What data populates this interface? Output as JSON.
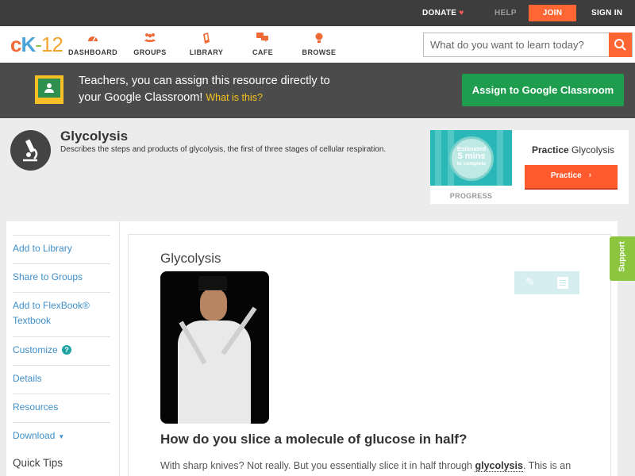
{
  "topbar": {
    "donate": "DONATE",
    "help": "HELP",
    "join": "JOIN",
    "signin": "SIGN IN"
  },
  "nav": {
    "logo": {
      "c": "c",
      "k": "K",
      "dash": "-",
      "num": "12"
    },
    "items": [
      {
        "label": "DASHBOARD",
        "icon": "dashboard-icon"
      },
      {
        "label": "GROUPS",
        "icon": "groups-icon"
      },
      {
        "label": "LIBRARY",
        "icon": "library-icon"
      },
      {
        "label": "CAFE",
        "icon": "cafe-icon"
      },
      {
        "label": "BROWSE",
        "icon": "browse-icon"
      }
    ],
    "search_placeholder": "What do you want to learn today?"
  },
  "banner": {
    "line1": "Teachers, you can assign this resource directly to",
    "line2": "your Google Classroom!",
    "what": "What is this?",
    "button": "Assign to Google Classroom"
  },
  "concept": {
    "title": "Glycolysis",
    "description": "Describes the steps and products of glycolysis, the first of three stages of cellular respiration."
  },
  "practice": {
    "estimated": "Estimated",
    "mins": "5 mins",
    "to_complete": "to complete",
    "progress": "PROGRESS",
    "title_bold": "Practice",
    "title_rest": "Glycolysis",
    "button": "Practice"
  },
  "sidebar": {
    "add_library": "Add to Library",
    "share_groups": "Share to Groups",
    "add_flexbook_1": "Add to FlexBook®",
    "add_flexbook_2": "Textbook",
    "customize": "Customize",
    "details": "Details",
    "resources": "Resources",
    "download": "Download",
    "quick_tips": "Quick Tips"
  },
  "main": {
    "title": "Glycolysis",
    "heading": "How do you slice a molecule of glucose in half?",
    "para_start": "With sharp knives? Not really. But you essentially slice it in half through ",
    "para_bold": "glycolysis",
    "para_end": ". This is an"
  },
  "support": "Support",
  "colors": {
    "accent": "#ff6633",
    "google_green": "#1e9d4f",
    "link": "#3f8fc8",
    "support_green": "#8cc63f"
  }
}
